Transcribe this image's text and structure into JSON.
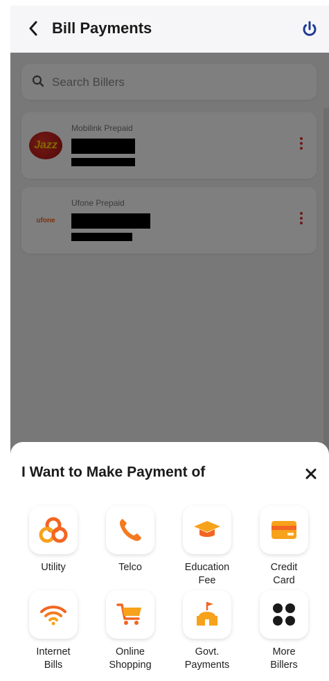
{
  "header": {
    "title": "Bill Payments"
  },
  "search": {
    "placeholder": "Search Billers"
  },
  "billers": [
    {
      "name": "Mobilink Prepaid",
      "logo_text": "Jazz"
    },
    {
      "name": "Ufone Prepaid",
      "logo_text": "ufone"
    }
  ],
  "sheet": {
    "title": "I Want to Make Payment of",
    "categories": [
      {
        "label": "Utility",
        "icon": "utility-icon"
      },
      {
        "label": "Telco",
        "icon": "phone-icon"
      },
      {
        "label": "Education\nFee",
        "icon": "graduation-cap-icon"
      },
      {
        "label": "Credit\nCard",
        "icon": "credit-card-icon"
      },
      {
        "label": "Internet\nBills",
        "icon": "wifi-icon"
      },
      {
        "label": "Online\nShopping",
        "icon": "shopping-cart-icon"
      },
      {
        "label": "Govt.\nPayments",
        "icon": "government-building-icon"
      },
      {
        "label": "More\nBillers",
        "icon": "more-grid-icon"
      }
    ]
  },
  "colors": {
    "accent_orange": "#f7a21b",
    "accent_red": "#e0302a",
    "power_blue": "#1f3a93"
  }
}
